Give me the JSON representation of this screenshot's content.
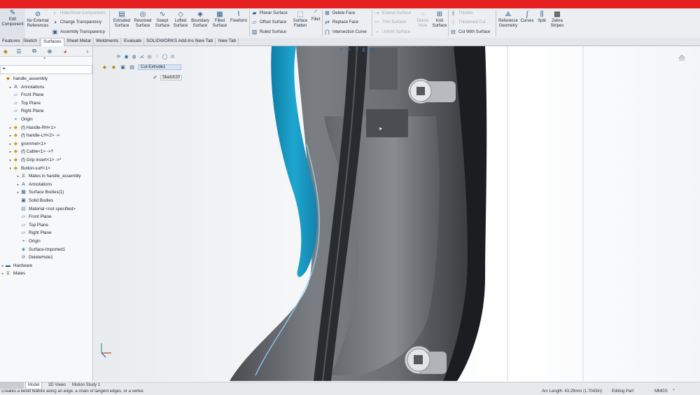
{
  "ribbon": {
    "edit_component": "Edit Component",
    "no_external_references": "No External References",
    "hide_show_components": "Hide/Show Components",
    "change_transparency": "Change Transparency",
    "assembly_transparency": "Assembly Transparency",
    "extruded_surface": "Extruded Surface",
    "revolved_surface": "Revolved Surface",
    "swept_surface": "Swept Surface",
    "lofted_surface": "Lofted Surface",
    "boundary_surface": "Boundary Surface",
    "filled_surface": "Filled Surface",
    "freeform": "Freeform",
    "planar_surface": "Planar Surface",
    "offset_surface": "Offset Surface",
    "ruled_surface": "Ruled Surface",
    "surface_flatten": "Surface Flatten",
    "fillet": "Fillet",
    "delete_face": "Delete Face",
    "replace_face": "Replace Face",
    "intersection_curve": "Intersection Curve",
    "extend_surface": "Extend Surface",
    "trim_surface": "Trim Surface",
    "untrim_surface": "Untrim Surface",
    "delete_hole": "Delete Hole",
    "knit_surface": "Knit Surface",
    "thicken": "Thicken",
    "thickened_cut": "Thickened Cut",
    "cut_with_surface": "Cut With Surface",
    "reference_geometry": "Reference Geometry",
    "curves": "Curves",
    "split": "Split",
    "zebra_stripes": "Zebra Stripes"
  },
  "tabs": [
    "Features",
    "Sketch",
    "Surfaces",
    "Sheet Metal",
    "Weldments",
    "Evaluate",
    "SOLIDWORKS Add-Ins",
    "New Tab",
    "New Tab"
  ],
  "flyout": {
    "cut_extrude": "Cut-Extrude1",
    "sketch": "Sketch20"
  },
  "tree": [
    {
      "label": "handle_assembly",
      "level": 0,
      "arrow": "",
      "icon": "assembly-icon"
    },
    {
      "label": "Annotations",
      "level": 1,
      "arrow": "▸",
      "icon": "annotations-icon"
    },
    {
      "label": "Front Plane",
      "level": 1,
      "arrow": "",
      "icon": "plane-icon"
    },
    {
      "label": "Top Plane",
      "level": 1,
      "arrow": "",
      "icon": "plane-icon"
    },
    {
      "label": "Right Plane",
      "level": 1,
      "arrow": "",
      "icon": "plane-icon"
    },
    {
      "label": "Origin",
      "level": 1,
      "arrow": "",
      "icon": "origin-icon"
    },
    {
      "label": "(f) Handle-RH<1>",
      "level": 1,
      "arrow": "▸",
      "icon": "part-icon"
    },
    {
      "label": "(f) handle-LH<2> ->",
      "level": 1,
      "arrow": "▸",
      "icon": "part-icon"
    },
    {
      "label": "grommet<1>",
      "level": 1,
      "arrow": "▸",
      "icon": "part-icon"
    },
    {
      "label": "(f) Cable<1> ->?",
      "level": 1,
      "arrow": "▸",
      "icon": "part-icon"
    },
    {
      "label": "(f) Grip insert<1> ->*",
      "level": 1,
      "arrow": "▸",
      "icon": "part-icon"
    },
    {
      "label": "Button-surf<1>",
      "level": 1,
      "arrow": "▾",
      "icon": "part-icon"
    },
    {
      "label": "Mates in handle_assembly",
      "level": 2,
      "arrow": "▸",
      "icon": "mates-icon"
    },
    {
      "label": "Annotations",
      "level": 2,
      "arrow": "▸",
      "icon": "annotations-icon"
    },
    {
      "label": "Surface Bodies(1)",
      "level": 2,
      "arrow": "▸",
      "icon": "surface-bodies-icon"
    },
    {
      "label": "Solid Bodies",
      "level": 2,
      "arrow": "",
      "icon": "solid-bodies-icon"
    },
    {
      "label": "Material <not specified>",
      "level": 2,
      "arrow": "",
      "icon": "material-icon"
    },
    {
      "label": "Front Plane",
      "level": 2,
      "arrow": "",
      "icon": "plane-icon"
    },
    {
      "label": "Top Plane",
      "level": 2,
      "arrow": "",
      "icon": "plane-icon"
    },
    {
      "label": "Right Plane",
      "level": 2,
      "arrow": "",
      "icon": "plane-icon"
    },
    {
      "label": "Origin",
      "level": 2,
      "arrow": "",
      "icon": "origin-icon"
    },
    {
      "label": "Surface-Imported1",
      "level": 2,
      "arrow": "",
      "icon": "surface-imported-icon"
    },
    {
      "label": "DeleteHole1",
      "level": 2,
      "arrow": "",
      "icon": "delete-hole-icon"
    },
    {
      "label": "Hardware",
      "level": 0,
      "arrow": "▸",
      "icon": "folder-icon"
    },
    {
      "label": "Mates",
      "level": 0,
      "arrow": "▸",
      "icon": "mates-icon"
    }
  ],
  "bottom_tabs": [
    "Model",
    "3D Views",
    "Motion Study 1"
  ],
  "status": {
    "hint": "Creates a bevel feature along an edge, a chain of tangent edges, or a vertex.",
    "arc_length": "Arc Length: 43.29mm (1.7043in)",
    "mode": "Editing Part",
    "units": "MMGS"
  },
  "colors": {
    "accent_red": "#e62020",
    "grip_blue": "#1ea6d0",
    "handle_gray": "#6b6e72"
  }
}
